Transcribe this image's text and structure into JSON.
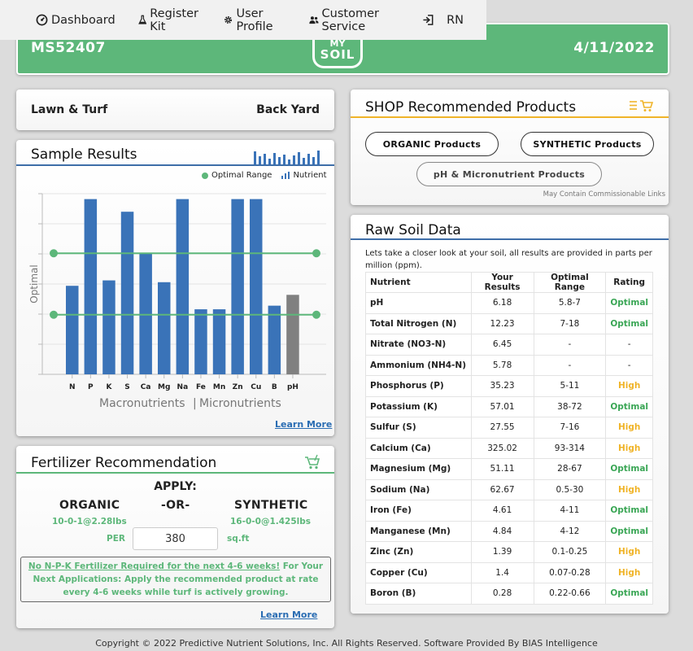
{
  "nav": {
    "items": [
      {
        "label": "Dashboard",
        "icon": "dashboard-gauge-icon"
      },
      {
        "label": "Register Kit",
        "icon": "flask-icon"
      },
      {
        "label": "User Profile",
        "icon": "gear-icon"
      },
      {
        "label": "Customer Service",
        "icon": "users-icon"
      },
      {
        "label": "RN",
        "icon": "sign-out-icon"
      }
    ]
  },
  "header": {
    "sample_id": "MS52407",
    "logo_line1": "MY",
    "logo_line2": "SOIL",
    "date": "4/11/2022"
  },
  "area": {
    "type": "Lawn & Turf",
    "location": "Back Yard"
  },
  "sample_results": {
    "title": "Sample Results",
    "legend_optimal": "Optimal Range",
    "legend_nutrient": "Nutrient",
    "group_macro": "Macronutrients",
    "group_sep": "|",
    "group_micro": "Micronutrients",
    "learn_more": "Learn More"
  },
  "chart_data": {
    "type": "bar",
    "categories": [
      "N",
      "P",
      "K",
      "S",
      "Ca",
      "Mg",
      "Na",
      "Fe",
      "Mn",
      "Zn",
      "Cu",
      "B",
      "pH"
    ],
    "values": [
      0.49,
      0.97,
      0.52,
      0.9,
      0.67,
      0.51,
      0.97,
      0.36,
      0.36,
      0.97,
      0.97,
      0.38,
      0.44
    ],
    "optimal_band": [
      0.33,
      0.67
    ],
    "ylabel": "Optimal",
    "ylim": [
      0,
      1
    ],
    "colors": {
      "nutrient": "#3a73b8",
      "ph": "#808080",
      "optimal": "#5db77a"
    },
    "grid": true
  },
  "fertilizer": {
    "title": "Fertilizer Recommendation",
    "apply_label": "APPLY:",
    "organic_label": "ORGANIC",
    "or_label": "-OR-",
    "synthetic_label": "SYNTHETIC",
    "organic_rate": "10-0-1@2.28lbs",
    "synthetic_rate": "16-0-0@1.425lbs",
    "per_label": "PER",
    "area_value": "380",
    "unit_label": "sq.ft",
    "note_link": "No N-P-K Fertilizer Required for the next 4-6 weeks!",
    "note_rest": " For Your Next Applications: Apply the recommended product at rate every 4-6 weeks while turf is actively growing.",
    "learn_more": "Learn More"
  },
  "shop": {
    "title": "SHOP Recommended Products",
    "organic_button": "ORGANIC Products",
    "synthetic_button": "SYNTHETIC Products",
    "ph_button": "pH & Micronutrient Products",
    "disclaimer": "May Contain Commissionable Links"
  },
  "raw": {
    "title": "Raw Soil Data",
    "intro": "Lets take a closer look at your soil, all results are provided in parts per million (ppm).",
    "headers": [
      "Nutrient",
      "Your Results",
      "Optimal Range",
      "Rating"
    ],
    "rows": [
      {
        "nutrient": "pH",
        "result": "6.18",
        "range": "5.8-7",
        "rating": "Optimal"
      },
      {
        "nutrient": "Total Nitrogen (N)",
        "result": "12.23",
        "range": "7-18",
        "rating": "Optimal"
      },
      {
        "nutrient": "Nitrate (NO3-N)",
        "result": "6.45",
        "range": "-",
        "rating": "-"
      },
      {
        "nutrient": "Ammonium (NH4-N)",
        "result": "5.78",
        "range": "-",
        "rating": "-"
      },
      {
        "nutrient": "Phosphorus (P)",
        "result": "35.23",
        "range": "5-11",
        "rating": "High"
      },
      {
        "nutrient": "Potassium (K)",
        "result": "57.01",
        "range": "38-72",
        "rating": "Optimal"
      },
      {
        "nutrient": "Sulfur (S)",
        "result": "27.55",
        "range": "7-16",
        "rating": "High"
      },
      {
        "nutrient": "Calcium (Ca)",
        "result": "325.02",
        "range": "93-314",
        "rating": "High"
      },
      {
        "nutrient": "Magnesium (Mg)",
        "result": "51.11",
        "range": "28-67",
        "rating": "Optimal"
      },
      {
        "nutrient": "Sodium (Na)",
        "result": "62.67",
        "range": "0.5-30",
        "rating": "High"
      },
      {
        "nutrient": "Iron (Fe)",
        "result": "4.61",
        "range": "4-11",
        "rating": "Optimal"
      },
      {
        "nutrient": "Manganese (Mn)",
        "result": "4.84",
        "range": "4-12",
        "rating": "Optimal"
      },
      {
        "nutrient": "Zinc (Zn)",
        "result": "1.39",
        "range": "0.1-0.25",
        "rating": "High"
      },
      {
        "nutrient": "Copper (Cu)",
        "result": "1.4",
        "range": "0.07-0.28",
        "rating": "High"
      },
      {
        "nutrient": "Boron (B)",
        "result": "0.28",
        "range": "0.22-0.66",
        "rating": "Optimal"
      }
    ]
  },
  "footer": {
    "text": "Copyright © 2022 Predictive Nutrient Solutions, Inc. All Rights Reserved. Software Provided By BIAS Intelligence"
  }
}
